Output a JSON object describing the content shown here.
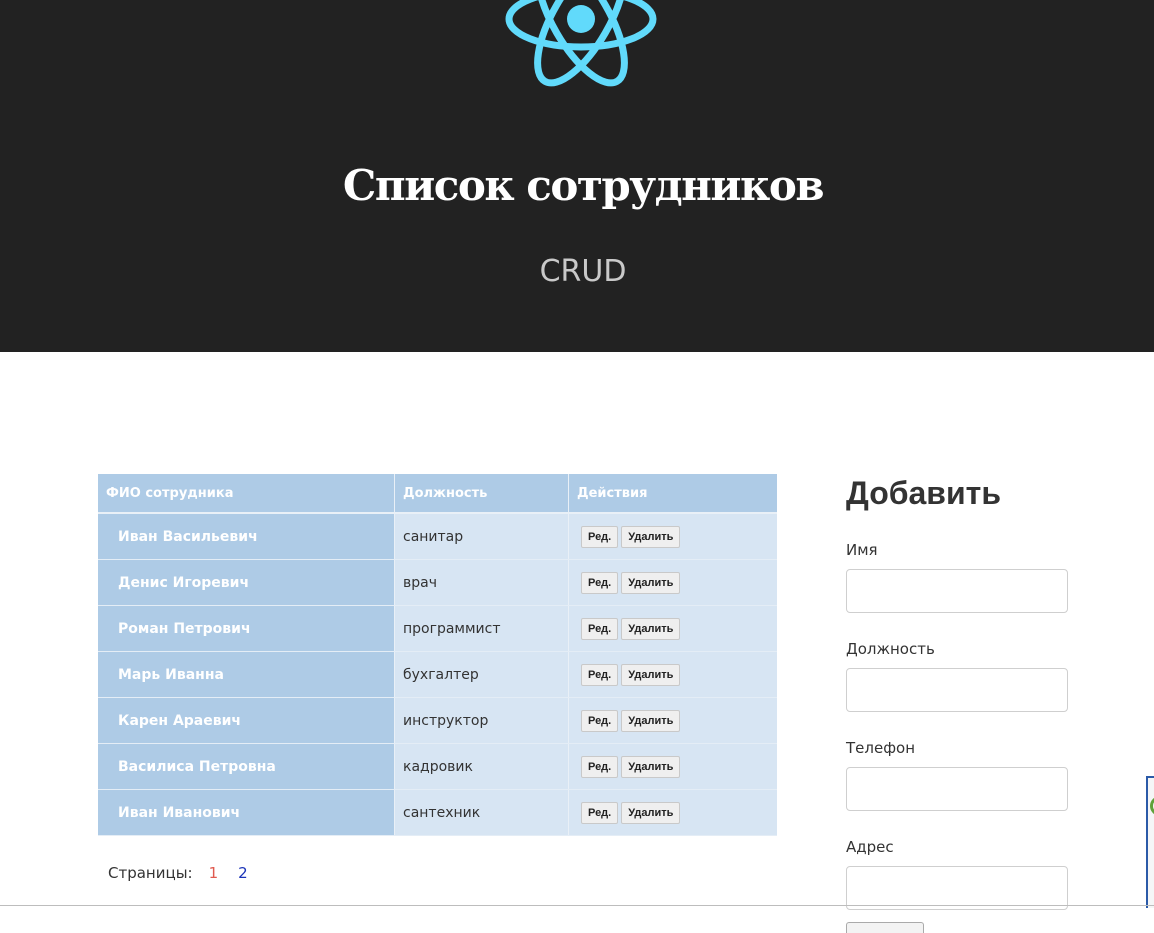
{
  "header": {
    "title": "Список сотрудников",
    "subtitle": "CRUD",
    "logo_icon": "react-atom-icon",
    "logo_color": "#61dafb",
    "background": "#222222"
  },
  "table": {
    "columns": [
      "ФИО сотрудника",
      "Должность",
      "Действия"
    ],
    "edit_label": "Ред.",
    "delete_label": "Удалить",
    "rows": [
      {
        "name": "Иван Васильевич",
        "position": "санитар"
      },
      {
        "name": "Денис Игоревич",
        "position": "врач"
      },
      {
        "name": "Роман Петрович",
        "position": "программист"
      },
      {
        "name": "Марь Иванна",
        "position": "бухгалтер"
      },
      {
        "name": "Карен Араевич",
        "position": "инструктор"
      },
      {
        "name": "Василиса Петровна",
        "position": "кадровик"
      },
      {
        "name": "Иван Иванович",
        "position": "сантехник"
      }
    ]
  },
  "pagination": {
    "label": "Страницы:",
    "pages": [
      "1",
      "2"
    ],
    "current": "1"
  },
  "form": {
    "title": "Добавить",
    "fields": [
      {
        "label": "Имя",
        "value": ""
      },
      {
        "label": "Должность",
        "value": ""
      },
      {
        "label": "Телефон",
        "value": ""
      },
      {
        "label": "Адрес",
        "value": ""
      }
    ]
  }
}
